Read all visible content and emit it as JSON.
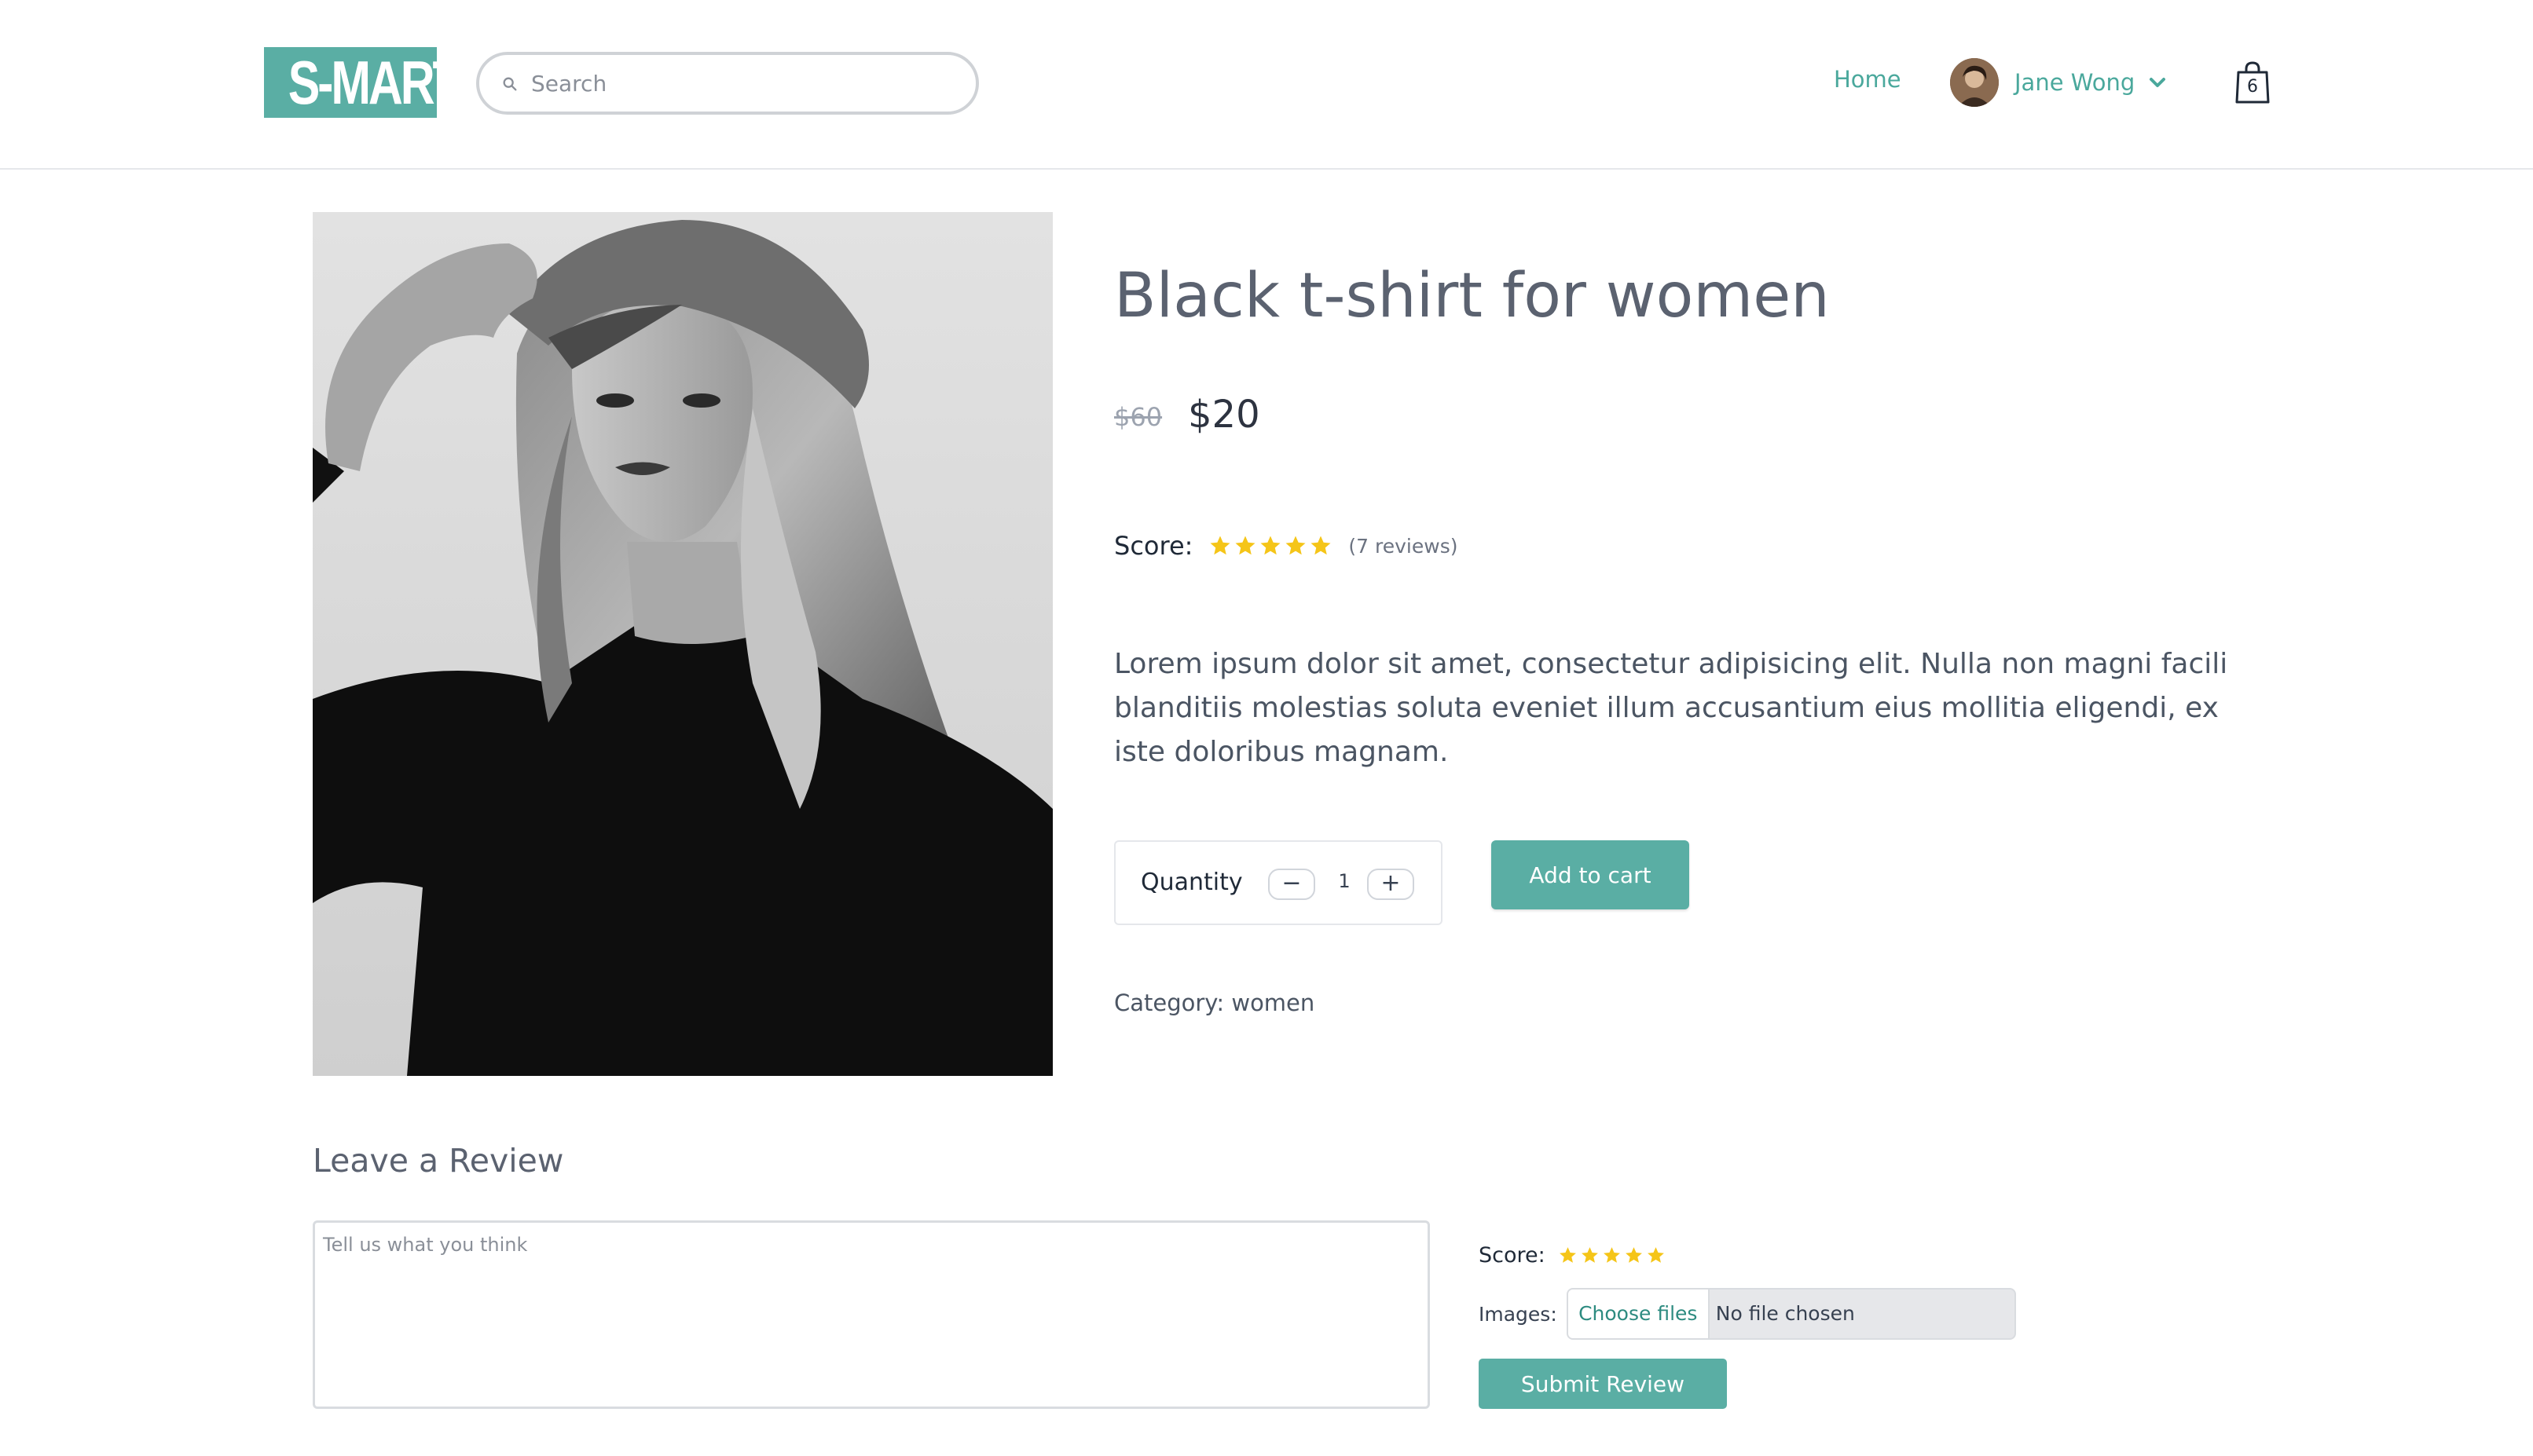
{
  "header": {
    "logo_text": "S-MART",
    "search_placeholder": "Search",
    "nav_home": "Home",
    "user_name": "Jane Wong",
    "cart_count": "6",
    "icons": [
      "search-icon",
      "chevron-down-icon",
      "shopping-bag-icon",
      "user-avatar"
    ]
  },
  "product": {
    "title": "Black t-shirt for women",
    "old_price": "$60",
    "price": "$20",
    "score_label": "Score:",
    "rating": 5,
    "reviews_count": "(7 reviews)",
    "description": "Lorem ipsum dolor sit amet, consectetur adipisicing elit. Nulla non magni facili blanditiis molestias soluta eveniet illum accusantium eius mollitia eligendi, ex iste doloribus magnam.",
    "quantity_label": "Quantity",
    "quantity_minus": "−",
    "quantity_value": "1",
    "quantity_plus": "+",
    "add_to_cart": "Add to cart",
    "category": "Category: women"
  },
  "review": {
    "heading": "Leave a Review",
    "placeholder": "Tell us what you think",
    "score_label": "Score:",
    "rating": 5,
    "images_label": "Images:",
    "choose_files": "Choose files",
    "no_file": "No file chosen",
    "submit": "Submit Review"
  },
  "colors": {
    "accent": "#5aaea4",
    "accent_text": "#4aa89c",
    "star": "#f5c518",
    "title": "#5b6270"
  }
}
